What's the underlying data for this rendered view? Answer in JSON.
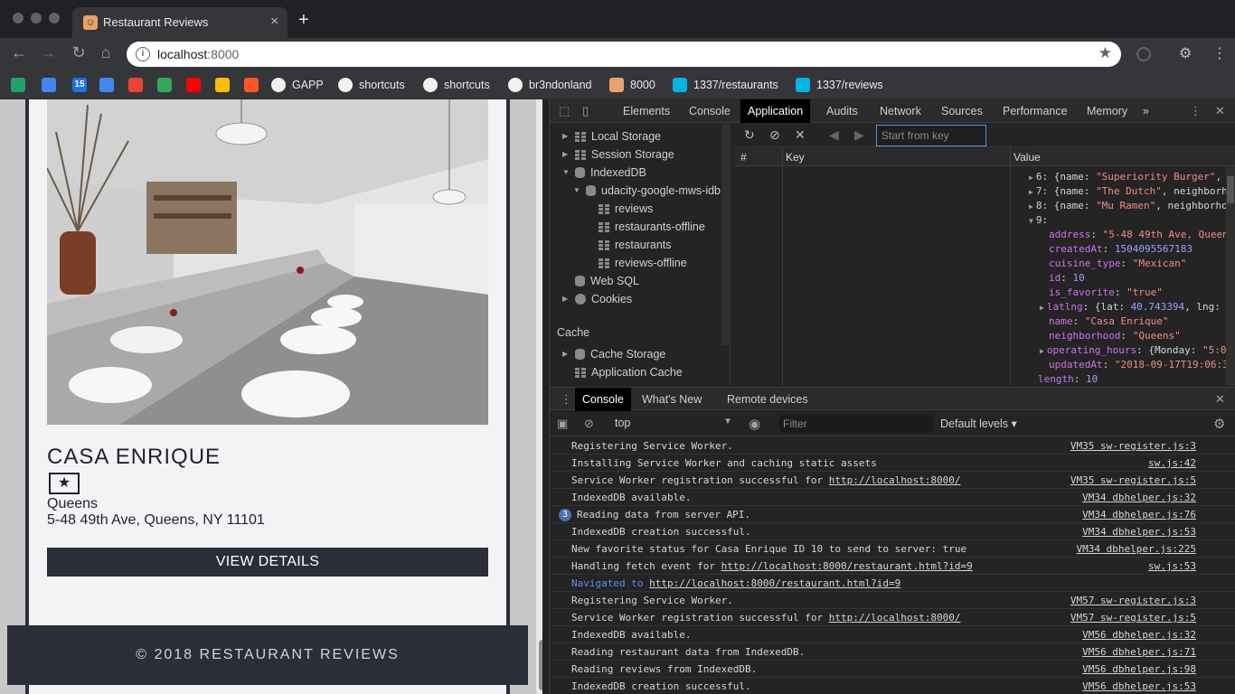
{
  "browser": {
    "tab_title": "Restaurant Reviews",
    "tab_close": "×",
    "new_tab": "+",
    "url_host": "localhost",
    "url_port": ":8000",
    "bookmarks": [
      {
        "label": "",
        "icon": "drive-icon",
        "color": "#1fa463"
      },
      {
        "label": "",
        "icon": "docs-icon",
        "color": "#4285f4"
      },
      {
        "label": "",
        "icon": "calendar-icon",
        "color": "#1a73e8",
        "glyph": "15"
      },
      {
        "label": "",
        "icon": "contacts-icon",
        "color": "#4285f4"
      },
      {
        "label": "",
        "icon": "gmail-icon",
        "color": "#ea4335"
      },
      {
        "label": "",
        "icon": "maps-icon",
        "color": "#34a853"
      },
      {
        "label": "",
        "icon": "youtube-icon",
        "color": "#ff0000"
      },
      {
        "label": "",
        "icon": "photos-icon",
        "color": "#fbbc04"
      },
      {
        "label": "",
        "icon": "music-icon",
        "color": "#ff5722"
      },
      {
        "label": "GAPP",
        "icon": "google-icon",
        "color": "#ffffff"
      },
      {
        "label": "shortcuts",
        "icon": "google-icon",
        "color": "#ffffff"
      },
      {
        "label": "shortcuts",
        "icon": "github-icon",
        "color": "#ffffff"
      },
      {
        "label": "br3ndonland",
        "icon": "github-icon",
        "color": "#ffffff"
      },
      {
        "label": "8000",
        "icon": "restaurant-favicon",
        "color": "#e8a36b"
      },
      {
        "label": "1337/restaurants",
        "icon": "udacity-icon",
        "color": "#02b3e4"
      },
      {
        "label": "1337/reviews",
        "icon": "udacity-icon",
        "color": "#02b3e4"
      }
    ]
  },
  "restaurant": {
    "name": "CASA ENRIQUE",
    "favorite_glyph": "★",
    "neighborhood": "Queens",
    "address": "5-48 49th Ave, Queens, NY 11101",
    "details_label": "VIEW DETAILS",
    "footer": "© 2018 RESTAURANT REVIEWS"
  },
  "devtools": {
    "tabs": [
      "Elements",
      "Console",
      "Application",
      "Audits",
      "Network",
      "Sources",
      "Performance",
      "Memory"
    ],
    "more": "»",
    "active_tab": "Application",
    "sidebar": {
      "local_storage": "Local Storage",
      "session_storage": "Session Storage",
      "indexeddb": "IndexedDB",
      "db_name": "udacity-google-mws-idb",
      "stores": [
        "reviews",
        "restaurants-offline",
        "restaurants",
        "reviews-offline"
      ],
      "web_sql": "Web SQL",
      "cookies": "Cookies",
      "cache_section": "Cache",
      "cache_storage": "Cache Storage",
      "app_cache": "Application Cache"
    },
    "key_placeholder": "Start from key",
    "columns": {
      "num": "#",
      "key": "Key",
      "value": "Value"
    },
    "value_lines": [
      {
        "tri": "▶",
        "parts": [
          [
            "p",
            "6: {name: "
          ],
          [
            "s",
            "\"Superiority Burger\""
          ],
          [
            "p",
            ", "
          ]
        ]
      },
      {
        "tri": "▶",
        "parts": [
          [
            "p",
            "7: {name: "
          ],
          [
            "s",
            "\"The Dutch\""
          ],
          [
            "p",
            ", neighborh"
          ]
        ]
      },
      {
        "tri": "▶",
        "parts": [
          [
            "p",
            "8: {name: "
          ],
          [
            "s",
            "\"Mu Ramen\""
          ],
          [
            "p",
            ", neighborho"
          ]
        ]
      },
      {
        "tri": "▼",
        "parts": [
          [
            "p",
            "9:"
          ]
        ]
      },
      {
        "tri": "",
        "parts": [
          [
            "k",
            "address"
          ],
          [
            "p",
            ": "
          ],
          [
            "s",
            "\"5-48 49th Ave, Queen"
          ]
        ]
      },
      {
        "tri": "",
        "parts": [
          [
            "k",
            "createdAt"
          ],
          [
            "p",
            ": "
          ],
          [
            "n",
            "1504095567183"
          ]
        ]
      },
      {
        "tri": "",
        "parts": [
          [
            "k",
            "cuisine_type"
          ],
          [
            "p",
            ": "
          ],
          [
            "s",
            "\"Mexican\""
          ]
        ]
      },
      {
        "tri": "",
        "parts": [
          [
            "k",
            "id"
          ],
          [
            "p",
            ": "
          ],
          [
            "n",
            "10"
          ]
        ]
      },
      {
        "tri": "",
        "parts": [
          [
            "k",
            "is_favorite"
          ],
          [
            "p",
            ": "
          ],
          [
            "s",
            "\"true\""
          ]
        ]
      },
      {
        "tri": "▶",
        "parts": [
          [
            "k",
            "latlng"
          ],
          [
            "p",
            ": {lat: "
          ],
          [
            "n",
            "40.743394"
          ],
          [
            "p",
            ", lng:"
          ]
        ]
      },
      {
        "tri": "",
        "parts": [
          [
            "k",
            "name"
          ],
          [
            "p",
            ": "
          ],
          [
            "s",
            "\"Casa Enrique\""
          ]
        ]
      },
      {
        "tri": "",
        "parts": [
          [
            "k",
            "neighborhood"
          ],
          [
            "p",
            ": "
          ],
          [
            "s",
            "\"Queens\""
          ]
        ]
      },
      {
        "tri": "▶",
        "parts": [
          [
            "k",
            "operating_hours"
          ],
          [
            "p",
            ": {Monday: "
          ],
          [
            "s",
            "\"5:0"
          ]
        ]
      },
      {
        "tri": "",
        "parts": [
          [
            "k",
            "updatedAt"
          ],
          [
            "p",
            ": "
          ],
          [
            "s",
            "\"2018-09-17T19:06:3"
          ]
        ]
      },
      {
        "tri": "",
        "parts": [
          [
            "k",
            "length"
          ],
          [
            "p",
            ": "
          ],
          [
            "n",
            "10"
          ]
        ]
      }
    ],
    "drawer_tabs": [
      "Console",
      "What's New",
      "Remote devices"
    ],
    "context": "top",
    "filter_placeholder": "Filter",
    "levels": "Default levels ▾",
    "messages": [
      {
        "text": "Registering Service Worker.",
        "src": "VM35 sw-register.js:3"
      },
      {
        "text": "Installing Service Worker and caching static assets",
        "src": "sw.js:42"
      },
      {
        "text": "Service Worker registration successful for ",
        "link": "http://localhost:8000/",
        "src": "VM35 sw-register.js:5"
      },
      {
        "text": "IndexedDB available.",
        "src": "VM34 dbhelper.js:32"
      },
      {
        "text": "Reading data from server API.",
        "src": "VM34 dbhelper.js:76",
        "badge": "3"
      },
      {
        "text": "IndexedDB creation successful.",
        "src": "VM34 dbhelper.js:53"
      },
      {
        "text": "New favorite status for Casa Enrique ID 10 to send to server: true",
        "src": "VM34 dbhelper.js:225"
      },
      {
        "text": "Handling fetch event for ",
        "link": "http://localhost:8000/restaurant.html?id=9",
        "src": "sw.js:53"
      },
      {
        "text": "Navigated to ",
        "link": "http://localhost:8000/restaurant.html?id=9",
        "src": "",
        "nav": true
      },
      {
        "text": "Registering Service Worker.",
        "src": "VM57 sw-register.js:3"
      },
      {
        "text": "Service Worker registration successful for ",
        "link": "http://localhost:8000/",
        "src": "VM57 sw-register.js:5"
      },
      {
        "text": "IndexedDB available.",
        "src": "VM56 dbhelper.js:32"
      },
      {
        "text": "Reading restaurant data from IndexedDB.",
        "src": "VM56 dbhelper.js:71"
      },
      {
        "text": "Reading reviews from IndexedDB.",
        "src": "VM56 dbhelper.js:98"
      },
      {
        "text": "IndexedDB creation successful.",
        "src": "VM56 dbhelper.js:53"
      }
    ]
  }
}
